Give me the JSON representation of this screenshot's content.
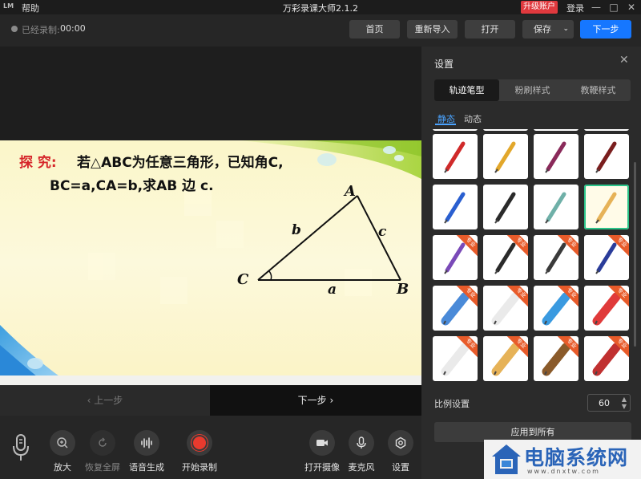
{
  "titlebar": {
    "logo": "LM",
    "help": "帮助",
    "title": "万彩录课大师2.1.2",
    "upgrade": "升级账户",
    "login": "登录",
    "minimize_icon": "minimize-icon",
    "maximize_icon": "maximize-icon",
    "close_icon": "close-icon"
  },
  "toolbar": {
    "rec_label": "已经录制:",
    "rec_time": "00:00",
    "home": "首页",
    "reimport": "重新导入",
    "open": "打开",
    "save": "保存",
    "next": "下一步"
  },
  "slide": {
    "explore": "探 究:",
    "line1": "若△ABC为任意三角形，已知角C,",
    "line2": "BC=a,CA=b,求AB 边 c.",
    "vertex_a": "A",
    "vertex_b": "B",
    "vertex_c": "C",
    "side_a": "a",
    "side_b": "b",
    "side_c": "c"
  },
  "nav": {
    "prev": "上一步",
    "next": "下一步"
  },
  "bottom": {
    "zoom": "放大",
    "restore": "恢复全屏",
    "voice": "语音生成",
    "record": "开始录制",
    "camera": "打开摄像",
    "mic": "麦克风",
    "settings": "设置"
  },
  "settings": {
    "title": "设置",
    "tabs": [
      "轨迹笔型",
      "粉刷样式",
      "教鞭样式"
    ],
    "subtabs": [
      "静态",
      "动态"
    ],
    "pro_badge": "专业",
    "scale_label": "比例设置",
    "scale_value": "60",
    "apply": "应用到所有"
  },
  "watermark": {
    "text": "电脑系统网",
    "sub": "www.dnxtw.com"
  },
  "colors": {
    "accent": "#1677ff",
    "upgrade": "#e0393e",
    "record": "#e83a2e",
    "selected_border": "#2bc48a"
  }
}
